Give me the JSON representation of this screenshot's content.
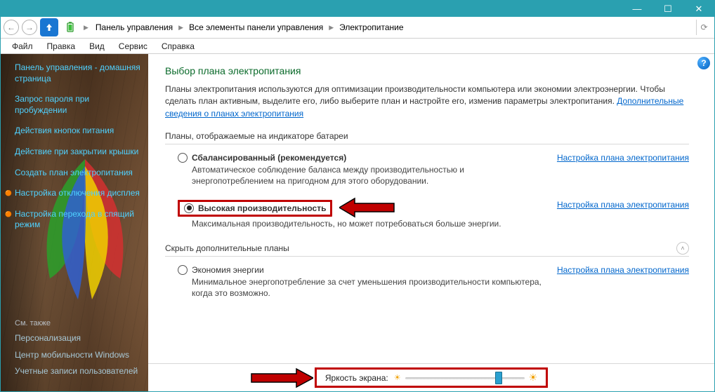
{
  "window": {
    "controls": {
      "min": "—",
      "max": "☐",
      "close": "✕"
    }
  },
  "breadcrumb": {
    "items": [
      "Панель управления",
      "Все элементы панели управления",
      "Электропитание"
    ]
  },
  "menu": {
    "items": [
      "Файл",
      "Правка",
      "Вид",
      "Сервис",
      "Справка"
    ]
  },
  "sidebar": {
    "home": "Панель управления - домашняя страница",
    "links": [
      "Запрос пароля при пробуждении",
      "Действия кнопок питания",
      "Действие при закрытии крышки",
      "Создать план электропитания",
      "Настройка отключения дисплея",
      "Настройка перехода в спящий режим"
    ],
    "seealso_heading": "См. также",
    "seealso": [
      "Персонализация",
      "Центр мобильности Windows",
      "Учетные записи пользователей"
    ]
  },
  "main": {
    "title": "Выбор плана электропитания",
    "intro_pre": "Планы электропитания используются для оптимизации производительности компьютера или экономии электроэнергии. Чтобы сделать план активным, выделите его, либо выберите план и настройте его, изменив параметры электропитания. ",
    "intro_link": "Дополнительные сведения о планах электропитания",
    "section1": "Планы, отображаемые на индикаторе батареи",
    "section2": "Скрыть дополнительные планы",
    "plans": [
      {
        "name": "Сбалансированный (рекомендуется)",
        "desc": "Автоматическое соблюдение баланса между производительностью и энергопотреблением на пригодном для этого оборудовании.",
        "link": "Настройка плана электропитания",
        "checked": false,
        "bold": true
      },
      {
        "name": "Высокая производительность",
        "desc": "Максимальная производительность, но может потребоваться больше энергии.",
        "link": "Настройка плана электропитания",
        "checked": true,
        "bold": true
      }
    ],
    "extra_plan": {
      "name": "Экономия энергии",
      "desc": "Минимальное энергопотребление за счет уменьшения производительности компьютера, когда это возможно.",
      "link": "Настройка плана электропитания"
    },
    "brightness_label": "Яркость экрана:",
    "brightness_percent": 75
  }
}
